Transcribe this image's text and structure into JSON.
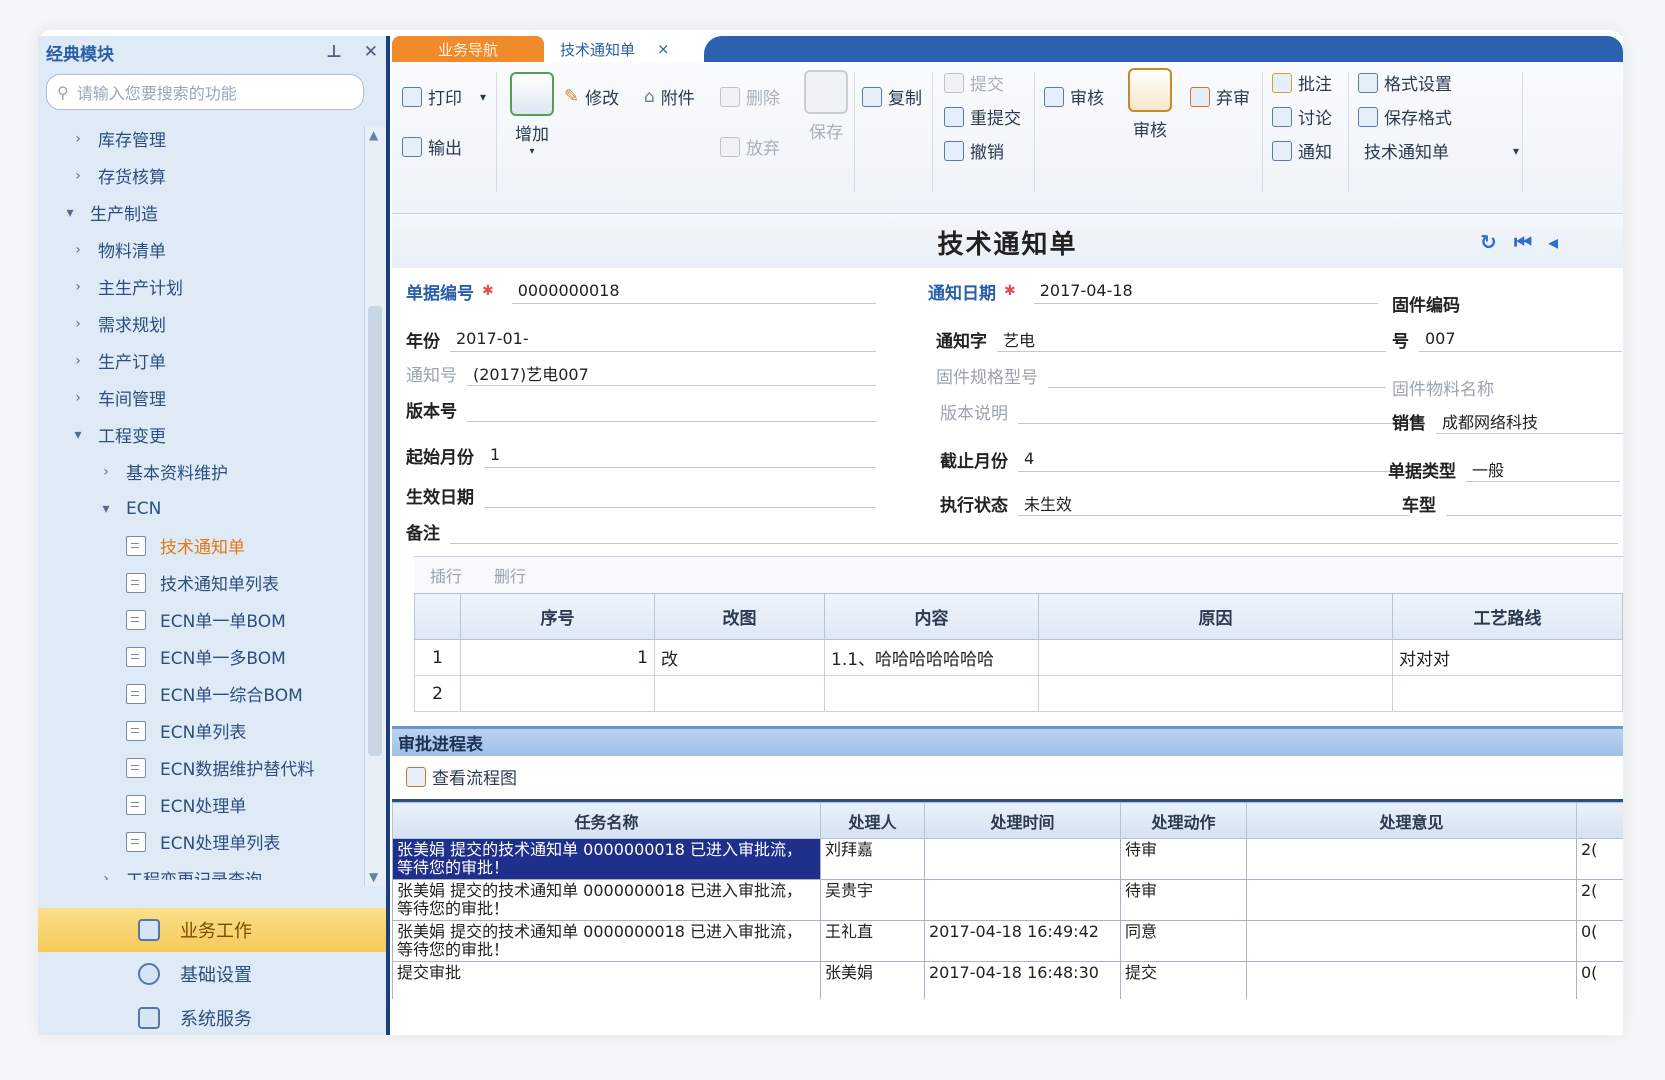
{
  "sidebar": {
    "title": "经典模块",
    "search_placeholder": "请输入您要搜索的功能",
    "tree": [
      {
        "label": "库存管理",
        "level": 1,
        "arrow": "›"
      },
      {
        "label": "存货核算",
        "level": 1,
        "arrow": "›"
      },
      {
        "label": "生产制造",
        "level": 0,
        "arrow": "▾"
      },
      {
        "label": "物料清单",
        "level": 1,
        "arrow": "›"
      },
      {
        "label": "主生产计划",
        "level": 1,
        "arrow": "›"
      },
      {
        "label": "需求规划",
        "level": 1,
        "arrow": "›"
      },
      {
        "label": "生产订单",
        "level": 1,
        "arrow": "›"
      },
      {
        "label": "车间管理",
        "level": 1,
        "arrow": "›"
      },
      {
        "label": "工程变更",
        "level": 1,
        "arrow": "▾"
      },
      {
        "label": "基本资料维护",
        "level": 2,
        "arrow": "›"
      },
      {
        "label": "ECN",
        "level": 2,
        "arrow": "▾"
      },
      {
        "label": "技术通知单",
        "level": 3,
        "doc": true,
        "active": true
      },
      {
        "label": "技术通知单列表",
        "level": 3,
        "doc": true
      },
      {
        "label": "ECN单一单BOM",
        "level": 3,
        "doc": true
      },
      {
        "label": "ECN单一多BOM",
        "level": 3,
        "doc": true
      },
      {
        "label": "ECN单一综合BOM",
        "level": 3,
        "doc": true
      },
      {
        "label": "ECN单列表",
        "level": 3,
        "doc": true
      },
      {
        "label": "ECN数据维护替代料",
        "level": 3,
        "doc": true
      },
      {
        "label": "ECN处理单",
        "level": 3,
        "doc": true
      },
      {
        "label": "ECN处理单列表",
        "level": 3,
        "doc": true
      },
      {
        "label": "工程变更记录查询",
        "level": 2,
        "arrow": "›"
      }
    ],
    "bottom": [
      {
        "label": "业务工作",
        "selected": true
      },
      {
        "label": "基础设置"
      },
      {
        "label": "系统服务"
      }
    ]
  },
  "tabs": {
    "active": "业务导航",
    "second": "技术通知单",
    "close": "×"
  },
  "toolbar": {
    "print": "打印",
    "output": "输出",
    "add": "增加",
    "modify": "修改",
    "attach": "附件",
    "delete": "删除",
    "abandon": "放弃",
    "save": "保存",
    "copy": "复制",
    "submit": "提交",
    "resubmit": "重提交",
    "revoke": "撤销",
    "review": "审核",
    "audit": "审核",
    "unaudit": "弃审",
    "approve": "批注",
    "discuss": "讨论",
    "notify": "通知",
    "format_set": "格式设置",
    "save_format": "保存格式",
    "format_name": "技术通知单"
  },
  "form": {
    "title": "技术通知单",
    "fields": {
      "doc_no": {
        "label": "单据编号",
        "value": "0000000018"
      },
      "notice_date": {
        "label": "通知日期",
        "value": "2017-04-18"
      },
      "fixed_code": {
        "label": "固件编码",
        "value": ""
      },
      "year": {
        "label": "年份",
        "value": "2017-01-"
      },
      "notice_word": {
        "label": "通知字",
        "value": "艺电"
      },
      "number": {
        "label": "号",
        "value": "007"
      },
      "notice_no": {
        "label": "通知号",
        "value": "(2017)艺电007"
      },
      "fixed_spec": {
        "label": "固件规格型号",
        "value": ""
      },
      "fixed_name": {
        "label": "固件物料名称",
        "value": ""
      },
      "version": {
        "label": "版本号",
        "value": ""
      },
      "version_desc": {
        "label": "版本说明",
        "value": ""
      },
      "sales": {
        "label": "销售",
        "value": "成都网络科技"
      },
      "start_month": {
        "label": "起始月份",
        "value": "1"
      },
      "end_month": {
        "label": "截止月份",
        "value": "4"
      },
      "doc_type": {
        "label": "单据类型",
        "value": "一般"
      },
      "effective_date": {
        "label": "生效日期",
        "value": ""
      },
      "exec_status": {
        "label": "执行状态",
        "value": "未生效"
      },
      "model": {
        "label": "车型",
        "value": ""
      },
      "remark": {
        "label": "备注",
        "value": ""
      }
    }
  },
  "detail_grid": {
    "toolbar": [
      "插行",
      "删行"
    ],
    "columns": [
      "序号",
      "改图",
      "内容",
      "原因",
      "工艺路线"
    ],
    "rows": [
      {
        "no": "1",
        "seq": "1",
        "change": "改",
        "content": "1.1、哈哈哈哈哈哈哈",
        "reason": "",
        "route": "对对对"
      },
      {
        "no": "2",
        "seq": "",
        "change": "",
        "content": "",
        "reason": "",
        "route": ""
      }
    ]
  },
  "approval": {
    "title": "审批进程表",
    "view_flow": "查看流程图",
    "columns": [
      "任务名称",
      "处理人",
      "处理时间",
      "处理动作",
      "处理意见"
    ],
    "rows": [
      {
        "task": "张美娟 提交的技术通知单 0000000018 已进入审批流，等待您的审批！",
        "handler": "刘拜嘉",
        "time": "",
        "action": "待审",
        "opinion": "",
        "extra": "2(",
        "highlight": true
      },
      {
        "task": "张美娟 提交的技术通知单 0000000018 已进入审批流，等待您的审批！",
        "handler": "吴贵宇",
        "time": "",
        "action": "待审",
        "opinion": "",
        "extra": "2("
      },
      {
        "task": "张美娟 提交的技术通知单 0000000018 已进入审批流，等待您的审批！",
        "handler": "王礼直",
        "time": "2017-04-18 16:49:42",
        "action": "同意",
        "opinion": "",
        "extra": "0("
      },
      {
        "task": "提交审批",
        "handler": "张美娟",
        "time": "2017-04-18 16:48:30",
        "action": "提交",
        "opinion": "",
        "extra": "0("
      }
    ]
  }
}
